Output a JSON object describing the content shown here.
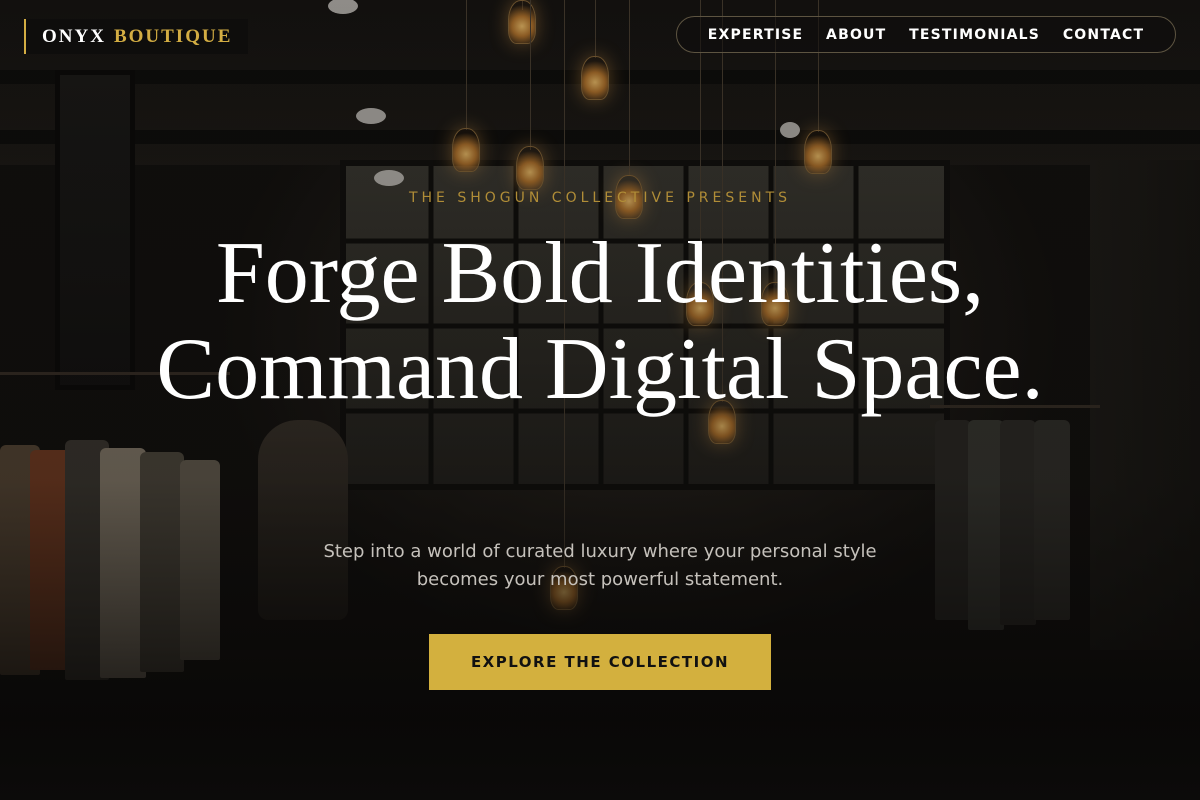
{
  "brand": {
    "name_part1": "ONYX",
    "name_part2": "BOUTIQUE",
    "accent_color": "#d3ad43"
  },
  "nav": {
    "items": [
      {
        "label": "EXPERTISE"
      },
      {
        "label": "ABOUT"
      },
      {
        "label": "TESTIMONIALS"
      },
      {
        "label": "CONTACT"
      }
    ]
  },
  "hero": {
    "eyebrow": "THE SHOGUN COLLECTIVE PRESENTS",
    "headline": "Forge Bold Identities, Command Digital Space.",
    "subtext": "Step into a world of curated luxury where your personal style becomes your most powerful statement.",
    "cta_label": "EXPLORE THE COLLECTION",
    "cta_color": "#d3b03e"
  }
}
